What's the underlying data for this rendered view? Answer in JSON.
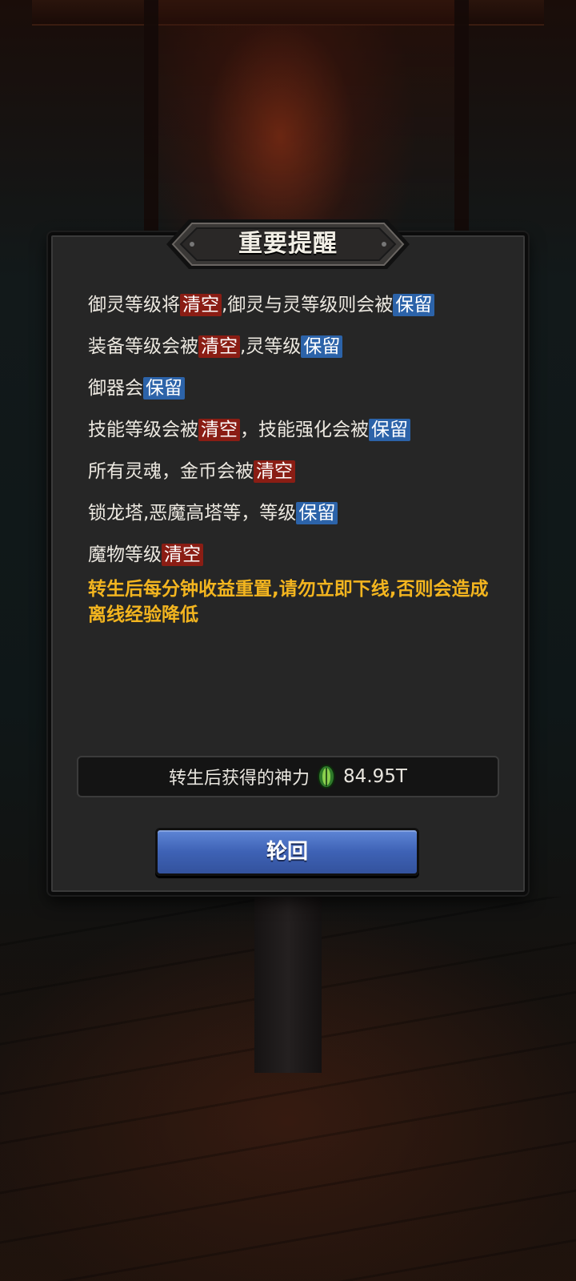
{
  "dialog": {
    "title": "重要提醒",
    "lines": [
      [
        {
          "t": "御灵等级将"
        },
        {
          "t": "清空",
          "tag": "red"
        },
        {
          "t": ",御灵与灵等级则会被"
        },
        {
          "t": "保留",
          "tag": "blue"
        }
      ],
      [
        {
          "t": "装备等级会被"
        },
        {
          "t": "清空",
          "tag": "red"
        },
        {
          "t": ",灵等级"
        },
        {
          "t": "保留",
          "tag": "blue"
        }
      ],
      [
        {
          "t": "御器会"
        },
        {
          "t": "保留",
          "tag": "blue"
        }
      ],
      [
        {
          "t": "技能等级会被"
        },
        {
          "t": "清空",
          "tag": "red"
        },
        {
          "t": "，技能强化会被"
        },
        {
          "t": "保留",
          "tag": "blue"
        }
      ],
      [
        {
          "t": "所有灵魂，金币会被"
        },
        {
          "t": "清空",
          "tag": "red"
        }
      ],
      [
        {
          "t": "锁龙塔,恶魔高塔等，等级"
        },
        {
          "t": "保留",
          "tag": "blue"
        }
      ],
      [
        {
          "t": "魔物等级"
        },
        {
          "t": "清空",
          "tag": "red"
        }
      ]
    ],
    "warning": "转生后每分钟收益重置,请勿立即下线,否则会造成离线经验降低",
    "divine_label": "转生后获得的神力",
    "divine_icon": "green-leaf-icon",
    "divine_amount": "84.95T",
    "confirm_button": "轮回"
  },
  "colors": {
    "clear_tag": "#8a1d14",
    "keep_tag": "#2c63a9",
    "warning": "#f3b51f",
    "button": "#3e62b5"
  }
}
